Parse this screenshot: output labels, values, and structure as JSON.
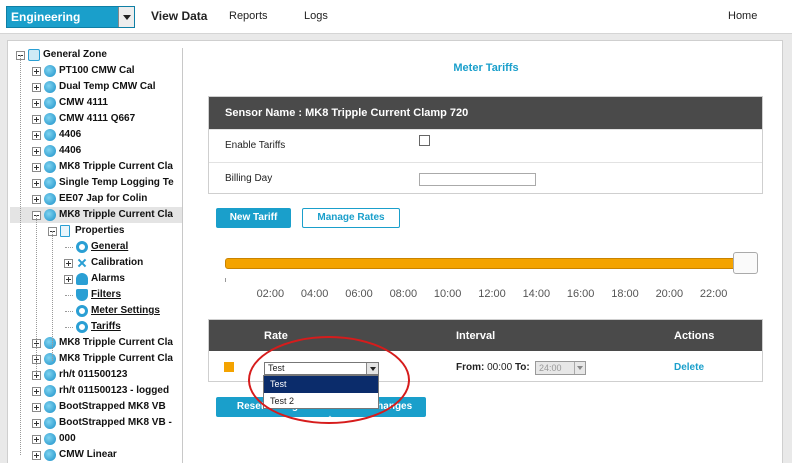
{
  "topbar": {
    "site": "Engineering",
    "nav": {
      "view_data": "View Data",
      "reports": "Reports",
      "logs": "Logs",
      "home": "Home"
    }
  },
  "tree": {
    "items": [
      {
        "label": "General Zone",
        "icon": "globe-icon"
      },
      {
        "label": "PT100 CMW Cal",
        "icon": "sensor-icon"
      },
      {
        "label": "Dual Temp CMW Cal",
        "icon": "sensor-icon"
      },
      {
        "label": "CMW 4111",
        "icon": "sensor-icon"
      },
      {
        "label": "CMW 4111 Q667",
        "icon": "sensor-icon"
      },
      {
        "label": "4406",
        "icon": "sensor-icon"
      },
      {
        "label": "4406",
        "icon": "sensor-icon"
      },
      {
        "label": "MK8 Tripple Current Cla",
        "icon": "sensor-icon"
      },
      {
        "label": "Single Temp Logging Te",
        "icon": "sensor-icon"
      },
      {
        "label": "EE07 Jap for Colin",
        "icon": "sensor-icon"
      },
      {
        "label": "MK8 Tripple Current Cla",
        "icon": "sensor-icon"
      },
      {
        "label": "Properties",
        "icon": "document-icon"
      },
      {
        "label": "General",
        "icon": "ring-icon"
      },
      {
        "label": "Calibration",
        "icon": "satellite-icon"
      },
      {
        "label": "Alarms",
        "icon": "bell-icon"
      },
      {
        "label": "Filters",
        "icon": "shield-icon"
      },
      {
        "label": "Meter Settings",
        "icon": "ring-icon"
      },
      {
        "label": "Tariffs",
        "icon": "ring-icon"
      },
      {
        "label": "MK8 Tripple Current Cla",
        "icon": "sensor-icon"
      },
      {
        "label": "MK8 Tripple Current Cla",
        "icon": "sensor-icon"
      },
      {
        "label": "rh/t 011500123",
        "icon": "sensor-icon"
      },
      {
        "label": "rh/t 011500123 - logged",
        "icon": "sensor-icon"
      },
      {
        "label": "BootStrapped MK8 VB",
        "icon": "sensor-icon"
      },
      {
        "label": "BootStrapped MK8 VB -",
        "icon": "sensor-icon"
      },
      {
        "label": "000",
        "icon": "sensor-icon"
      },
      {
        "label": "CMW Linear",
        "icon": "sensor-icon"
      }
    ]
  },
  "main": {
    "title": "Meter Tariffs",
    "sensor": {
      "heading": "Sensor Name : MK8 Tripple Current Clamp 720",
      "enable_label": "Enable Tariffs",
      "enable_checked": false,
      "billing_label": "Billing Day",
      "billing_value": ""
    },
    "buttons": {
      "new_tariff": "New Tariff",
      "manage_rates": "Manage Rates",
      "reset": "Reset Changes",
      "save": "Save Changes"
    },
    "slider": {
      "tick_labels": [
        "02:00",
        "04:00",
        "06:00",
        "08:00",
        "10:00",
        "12:00",
        "14:00",
        "16:00",
        "18:00",
        "20:00",
        "22:00"
      ]
    },
    "rates": {
      "headers": {
        "rate": "Rate",
        "interval": "Interval",
        "actions": "Actions"
      },
      "row": {
        "selected_rate": "Test",
        "from_label": "From:",
        "from_value": "00:00",
        "to_label": "To:",
        "to_value": "24:00",
        "delete": "Delete"
      },
      "options": [
        "Test",
        "Test 2"
      ]
    }
  },
  "colors": {
    "accent": "#1a9fcb",
    "tariff": "#f4a300",
    "header_dark": "#4a4a4a",
    "annotation": "#d61c1c"
  }
}
